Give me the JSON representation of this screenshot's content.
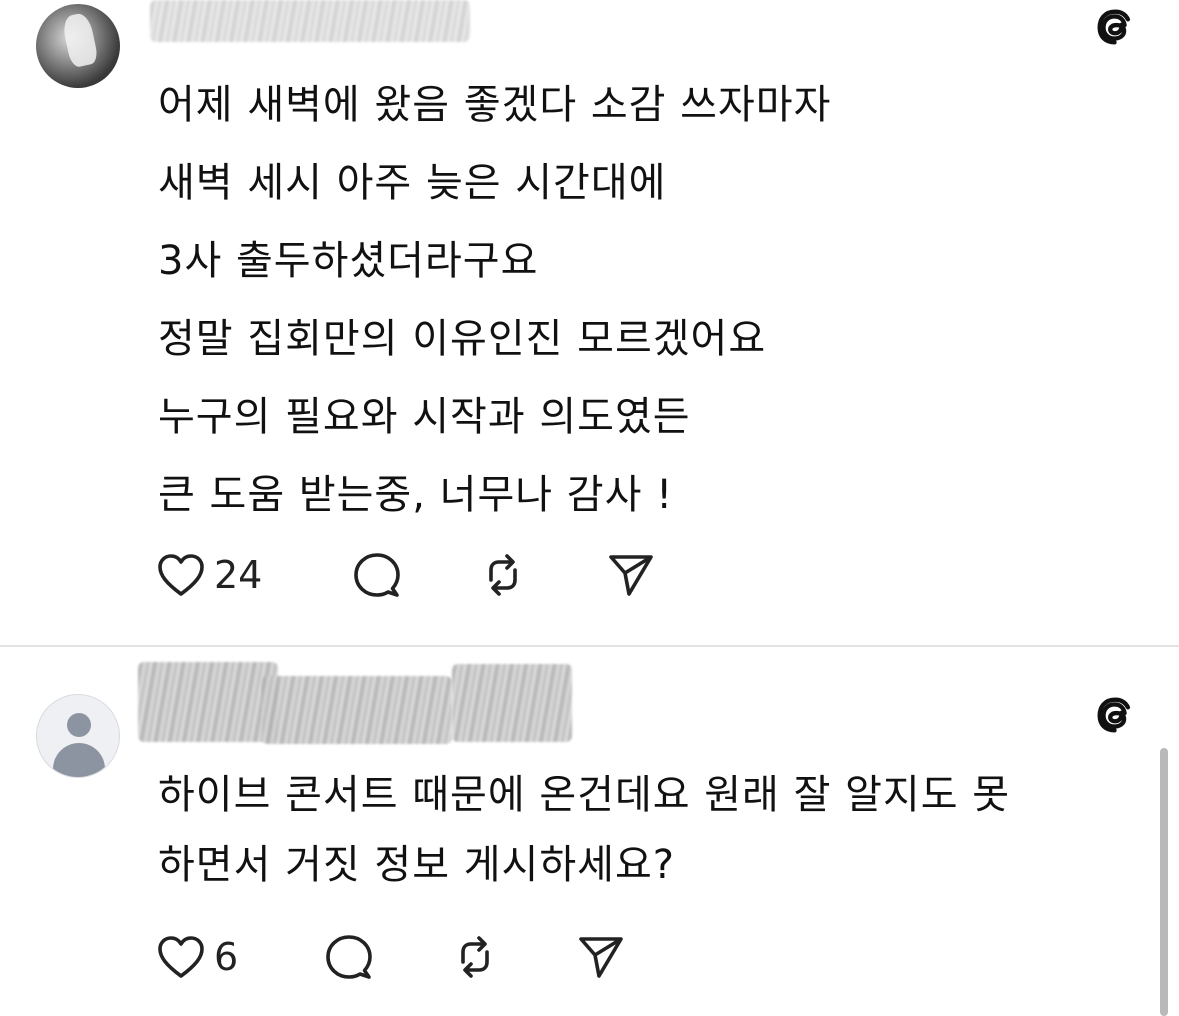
{
  "posts": [
    {
      "username": "",
      "body_lines": [
        "어제 새벽에 왔음 좋겠다 소감 쓰자마자",
        "새벽 세시 아주 늦은 시간대에",
        "3사 출두하셨더라구요",
        "정말 집회만의 이유인진 모르겠어요",
        "누구의 필요와 시작과 의도였든",
        "큰 도움 받는중, 너무나 감사 !"
      ],
      "likes": "24"
    },
    {
      "username": "",
      "body_lines": [
        "하이브 콘서트 때문에 온건데요 원래 잘 알지도 못",
        "하면서 거짓 정보 게시하세요?"
      ],
      "likes": "6"
    }
  ],
  "icons": {
    "brand": "threads-logo-icon",
    "like": "heart-icon",
    "reply": "comment-bubble-icon",
    "repost": "repost-arrows-icon",
    "share": "send-icon",
    "default_avatar": "default-avatar-icon"
  },
  "colors": {
    "text": "#111111",
    "icon": "#222222",
    "divider": "#e3e3e3",
    "background": "#ffffff"
  }
}
